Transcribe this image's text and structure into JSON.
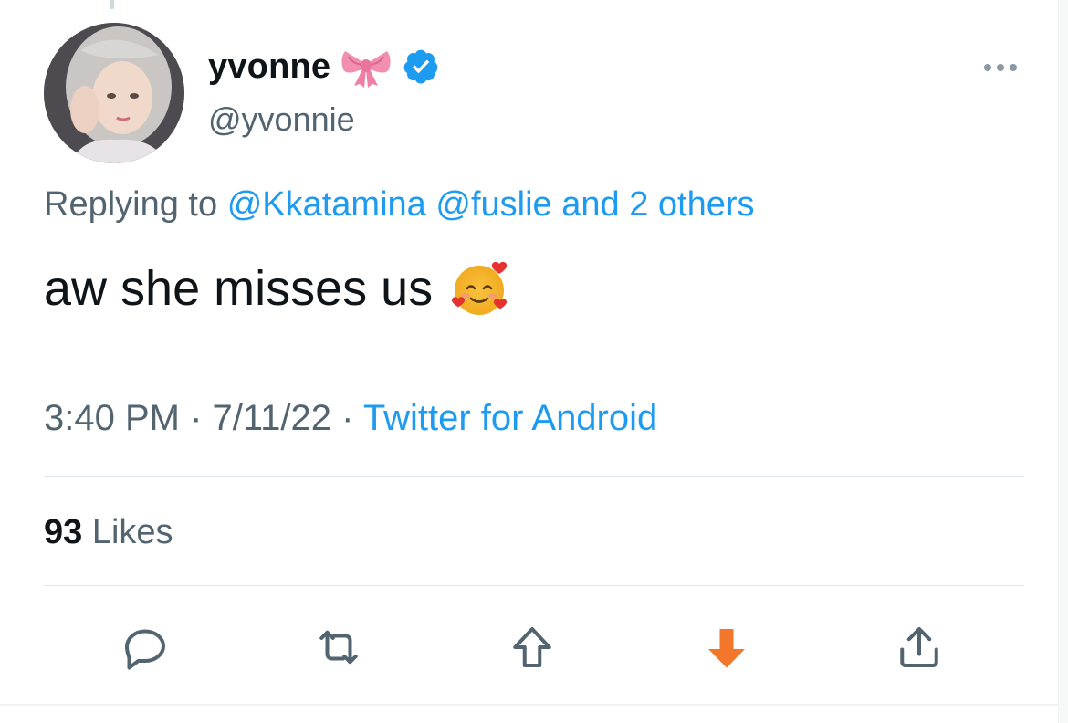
{
  "tweet": {
    "display_name": "yvonne",
    "handle": "@yvonnie",
    "replying_prefix": "Replying to",
    "reply_mentions": [
      "@Kkatamina",
      "@fuslie"
    ],
    "reply_others": "and 2 others",
    "text": "aw she misses us",
    "time": "3:40 PM",
    "date": "7/11/22",
    "separator": "·",
    "source": "Twitter for Android",
    "likes_count": "93",
    "likes_label": "Likes"
  },
  "icons": {
    "name_emoji": "ribbon-bow-icon",
    "verified": "verified-badge-icon",
    "text_emoji": "smiling-face-with-hearts-icon",
    "more": "more-options-icon",
    "actions": [
      "reply-icon",
      "retweet-icon",
      "upvote-icon",
      "downvote-icon",
      "share-icon"
    ]
  },
  "colors": {
    "link": "#1d9bf0",
    "muted": "#536471",
    "downvote_active": "#f2772b"
  }
}
